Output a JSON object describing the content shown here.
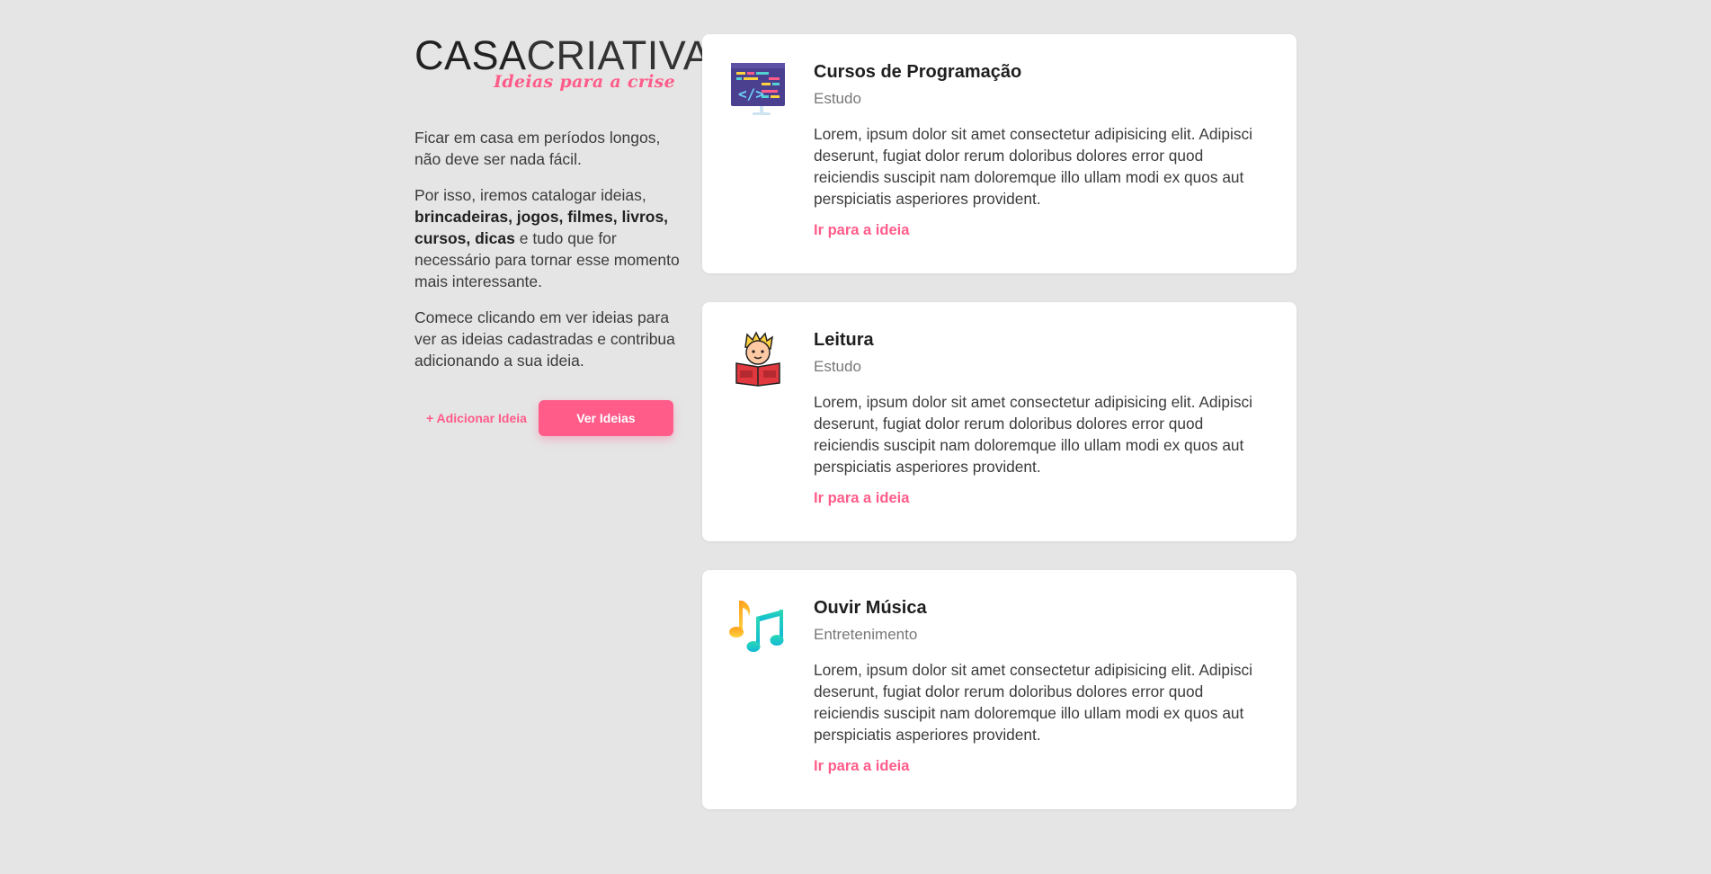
{
  "brand": {
    "casa": "CASA",
    "criativa": "CRIATIVA",
    "tagline": "Ideias para a crise",
    "accent_color": "#ff5c8a"
  },
  "intro": {
    "p1": "Ficar em casa em períodos longos, não deve ser nada fácil.",
    "p2_before": "Por isso, iremos catalogar ideias, ",
    "p2_bold": "brincadeiras, jogos, filmes, livros, cursos, dicas",
    "p2_after": " e tudo que for necessário para tornar esse momento mais interessante.",
    "p3": "Comece clicando em ver ideias para ver as ideias cadastradas e contribua adicionando a sua ideia."
  },
  "actions": {
    "add_label": "+ Adicionar Ideia",
    "see_label": "Ver Ideias"
  },
  "ideas": [
    {
      "icon": "programming-monitor-icon",
      "title": "Cursos de Programação",
      "category": "Estudo",
      "description": "Lorem, ipsum dolor sit amet consectetur adipisicing elit. Adipisci deserunt, fugiat dolor rerum doloribus dolores error quod reiciendis suscipit nam doloremque illo ullam modi ex quos aut perspiciatis asperiores provident.",
      "link": "Ir para a ideia"
    },
    {
      "icon": "reading-boy-icon",
      "title": "Leitura",
      "category": "Estudo",
      "description": "Lorem, ipsum dolor sit amet consectetur adipisicing elit. Adipisci deserunt, fugiat dolor rerum doloribus dolores error quod reiciendis suscipit nam doloremque illo ullam modi ex quos aut perspiciatis asperiores provident.",
      "link": "Ir para a ideia"
    },
    {
      "icon": "music-notes-icon",
      "title": "Ouvir Música",
      "category": "Entretenimento",
      "description": "Lorem, ipsum dolor sit amet consectetur adipisicing elit. Adipisci deserunt, fugiat dolor rerum doloribus dolores error quod reiciendis suscipit nam doloremque illo ullam modi ex quos aut perspiciatis asperiores provident.",
      "link": "Ir para a ideia"
    }
  ]
}
